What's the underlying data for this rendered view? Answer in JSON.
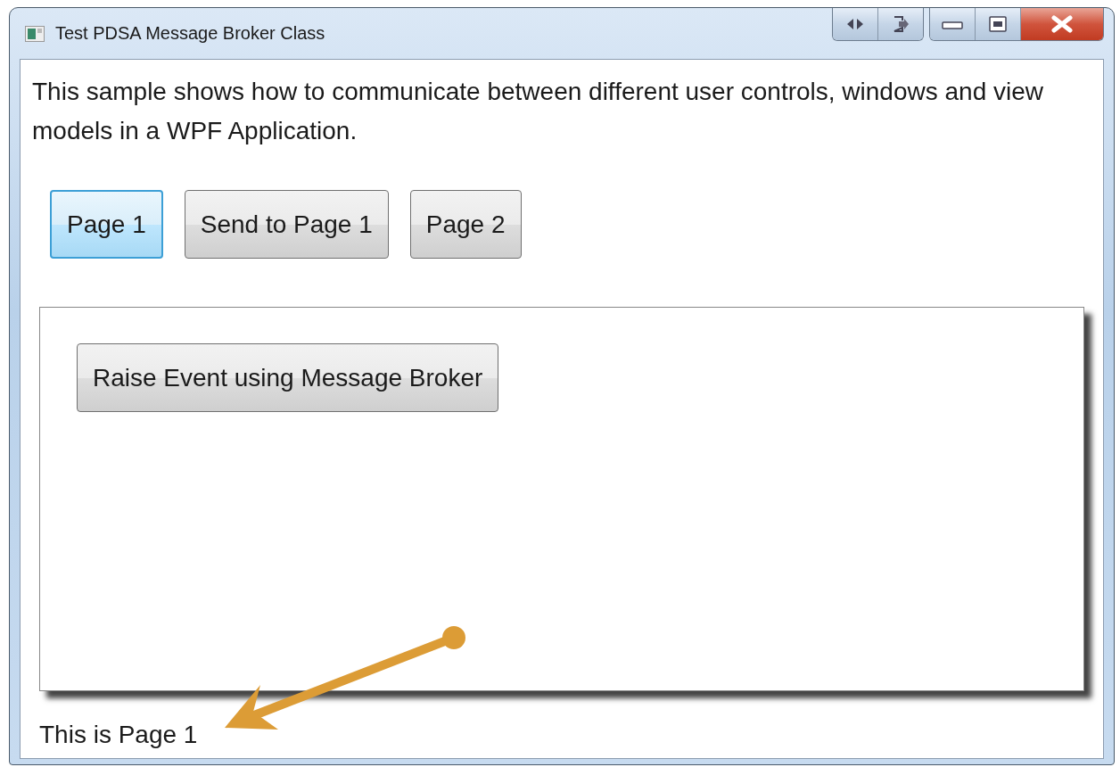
{
  "window": {
    "title": "Test PDSA Message Broker Class"
  },
  "description": "This sample shows how to communicate between different user controls, windows and view models in a WPF Application.",
  "nav_buttons": [
    {
      "label": "Page 1",
      "focused": true
    },
    {
      "label": "Send to Page 1",
      "focused": false
    },
    {
      "label": "Page 2",
      "focused": false
    }
  ],
  "page_panel": {
    "button": "Raise Event using Message Broker"
  },
  "status_text": "This is Page 1"
}
